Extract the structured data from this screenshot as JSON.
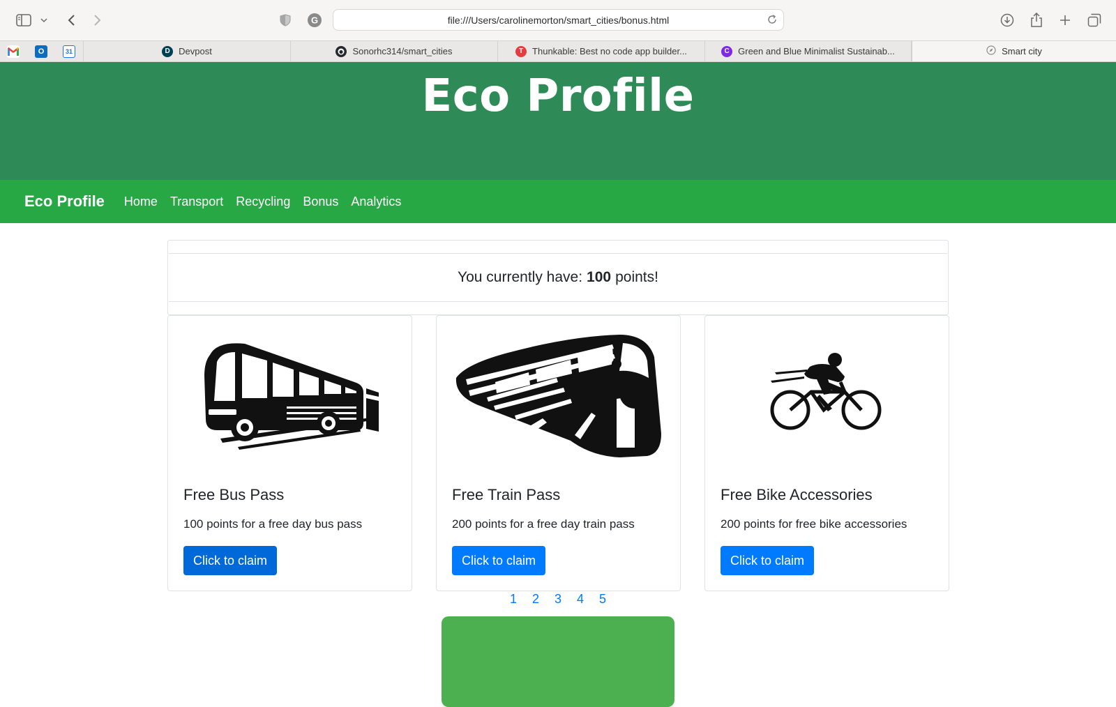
{
  "browser": {
    "url": "file:///Users/carolinemorton/smart_cities/bonus.html",
    "bookmarks": [
      {
        "icon": "gmail-icon",
        "letter": "M",
        "color": "#ea4335"
      },
      {
        "icon": "outlook-icon",
        "letter": "O",
        "color": "#0f6cbd"
      },
      {
        "icon": "calendar-icon",
        "letter": "31",
        "color": "#1a73e8"
      }
    ],
    "tabs": [
      {
        "label": "Devpost",
        "icon": "devpost-icon",
        "icon_letter": "D",
        "icon_color": "#003e54"
      },
      {
        "label": "Sonorhc314/smart_cities",
        "icon": "github-icon",
        "icon_letter": "◉",
        "icon_color": "#24292f"
      },
      {
        "label": "Thunkable: Best no code app builder...",
        "icon": "thunkable-icon",
        "icon_letter": "T",
        "icon_color": "#e43d3d"
      },
      {
        "label": "Green and Blue Minimalist Sustainab...",
        "icon": "canva-icon",
        "icon_letter": "C",
        "icon_color": "#7d2ae8"
      },
      {
        "label": "Smart city",
        "icon": "compass-icon",
        "icon_letter": "⊘",
        "icon_color": "#8a8a8a"
      }
    ]
  },
  "page": {
    "hero_title": "Eco Profile",
    "nav": {
      "brand": "Eco Profile",
      "links": [
        "Home",
        "Transport",
        "Recycling",
        "Bonus",
        "Analytics"
      ]
    },
    "points": {
      "prefix": "You currently have:",
      "value": "100",
      "suffix": "points!"
    },
    "cards": [
      {
        "title": "Free Bus Pass",
        "text": "100 points for a free day bus pass",
        "button": "Click to claim",
        "image": "bus-icon"
      },
      {
        "title": "Free Train Pass",
        "text": "200 points for a free day train pass",
        "button": "Click to claim",
        "image": "train-icon"
      },
      {
        "title": "Free Bike Accessories",
        "text": "200 points for free bike accessories",
        "button": "Click to claim",
        "image": "bicycle-icon"
      }
    ],
    "pagination": [
      "1",
      "2",
      "3",
      "4",
      "5"
    ]
  },
  "colors": {
    "hero": "#2e8b57",
    "navbar": "#28a745",
    "button": "#007bff",
    "green_block": "#4caf50"
  }
}
